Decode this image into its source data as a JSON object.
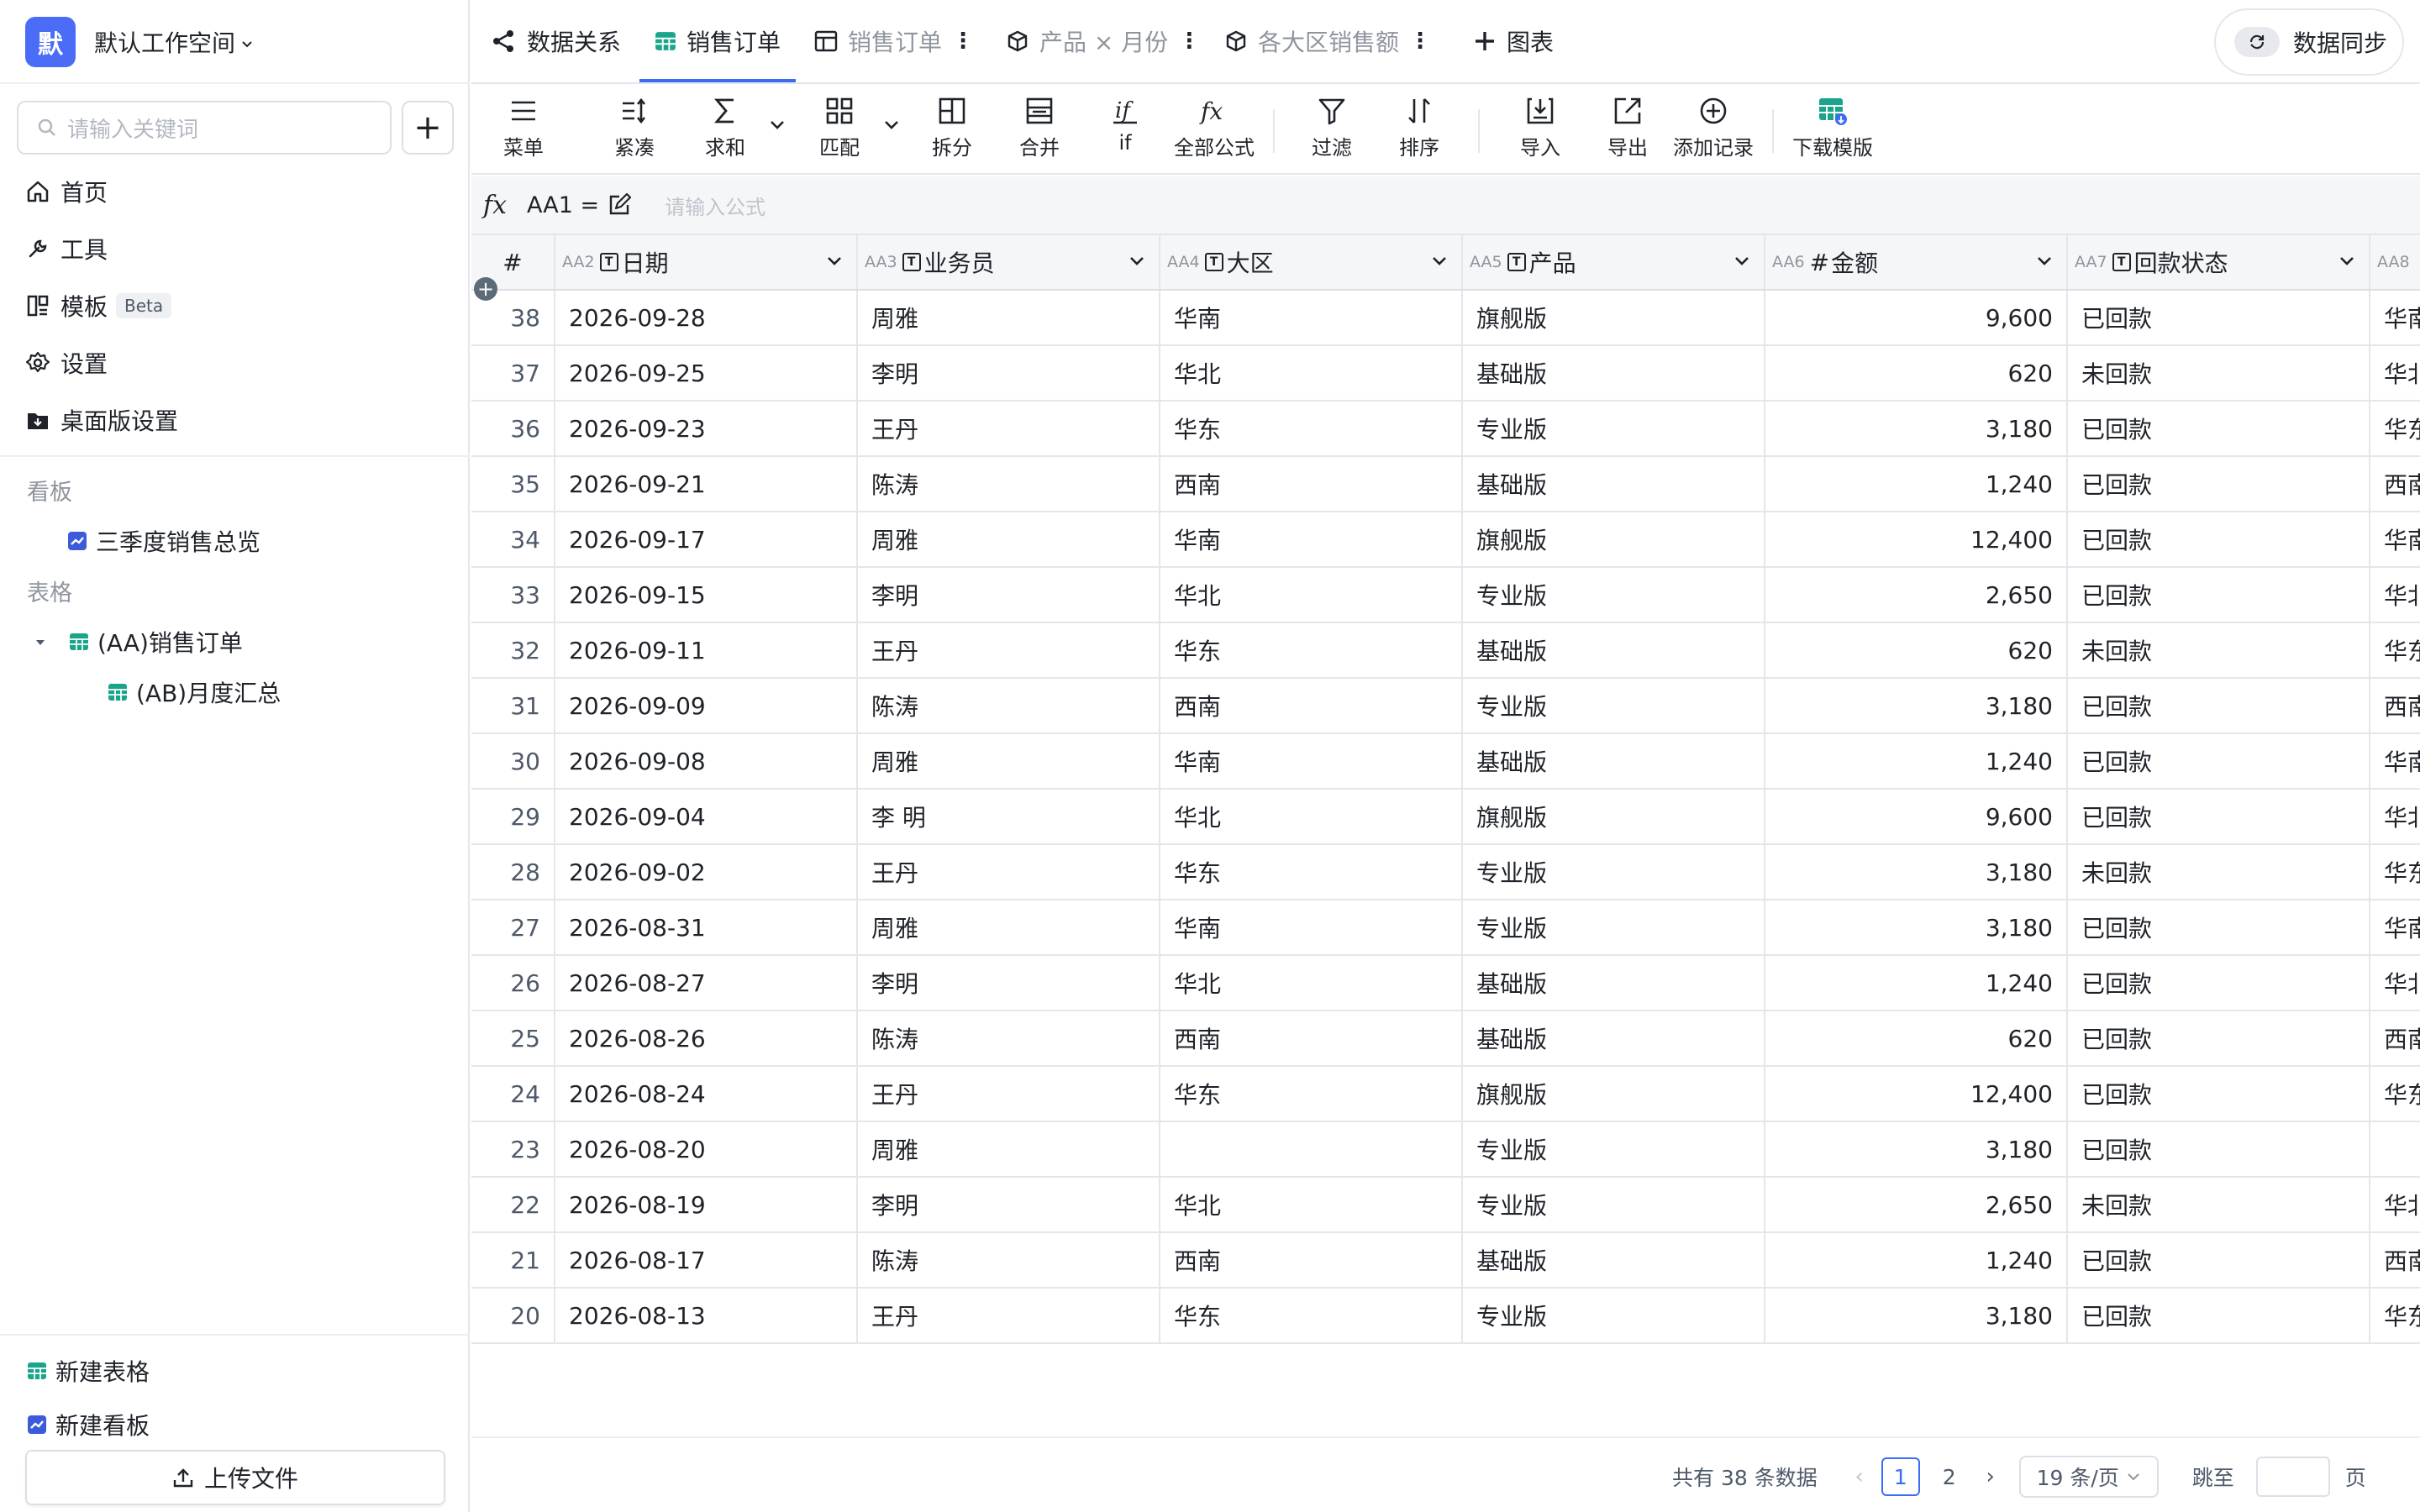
{
  "workspace": {
    "avatar": "默",
    "name": "默认工作空间"
  },
  "search": {
    "placeholder": "请输入关键词"
  },
  "nav": [
    {
      "label": "首页"
    },
    {
      "label": "工具"
    },
    {
      "label": "模板",
      "badge": "Beta"
    },
    {
      "label": "设置"
    },
    {
      "label": "桌面版设置"
    }
  ],
  "sections": {
    "boards": "看板",
    "tables": "表格"
  },
  "board_items": [
    {
      "label": "三季度销售总览"
    }
  ],
  "table_tree": [
    {
      "label": "(AA)销售订单"
    },
    {
      "label": "(AB)月度汇总"
    }
  ],
  "sidebar_footer": {
    "new_table": "新建表格",
    "new_board": "新建看板",
    "upload": "上传文件"
  },
  "tabs": [
    {
      "label": "数据关系"
    },
    {
      "label": "销售订单"
    },
    {
      "label": "销售订单"
    },
    {
      "label": "产品 × 月份"
    },
    {
      "label": "各大区销售额"
    },
    {
      "label": "图表"
    }
  ],
  "sync": {
    "label": "数据同步"
  },
  "toolbar": [
    "菜单",
    "紧凑",
    "求和",
    "匹配",
    "拆分",
    "合并",
    "if",
    "全部公式",
    "过滤",
    "排序",
    "导入",
    "导出",
    "添加记录",
    "下载模版"
  ],
  "formula": {
    "cell": "AA1 =",
    "placeholder": "请输入公式"
  },
  "columns": [
    {
      "id": "",
      "name": "#"
    },
    {
      "id": "AA2",
      "name": "日期",
      "type": "T"
    },
    {
      "id": "AA3",
      "name": "业务员",
      "type": "T"
    },
    {
      "id": "AA4",
      "name": "大区",
      "type": "T"
    },
    {
      "id": "AA5",
      "name": "产品",
      "type": "T"
    },
    {
      "id": "AA6",
      "name": "金额",
      "type": "#"
    },
    {
      "id": "AA7",
      "name": "回款状态",
      "type": "T"
    },
    {
      "id": "AA8",
      "name": "",
      "type": ""
    }
  ],
  "rows": [
    [
      "38",
      "2026-09-28",
      "周雅",
      "华南",
      "旗舰版",
      "9,600",
      "已回款",
      "华南"
    ],
    [
      "37",
      "2026-09-25",
      "李明",
      "华北",
      "基础版",
      "620",
      "未回款",
      "华北"
    ],
    [
      "36",
      "2026-09-23",
      "王丹",
      "华东",
      "专业版",
      "3,180",
      "已回款",
      "华东"
    ],
    [
      "35",
      "2026-09-21",
      "陈涛",
      "西南",
      "基础版",
      "1,240",
      "已回款",
      "西南"
    ],
    [
      "34",
      "2026-09-17",
      "周雅",
      "华南",
      "旗舰版",
      "12,400",
      "已回款",
      "华南"
    ],
    [
      "33",
      "2026-09-15",
      "李明",
      "华北",
      "专业版",
      "2,650",
      "已回款",
      "华北"
    ],
    [
      "32",
      "2026-09-11",
      "王丹",
      "华东",
      "基础版",
      "620",
      "未回款",
      "华东"
    ],
    [
      "31",
      "2026-09-09",
      "陈涛",
      "西南",
      "专业版",
      "3,180",
      "已回款",
      "西南"
    ],
    [
      "30",
      "2026-09-08",
      "周雅",
      "华南",
      "基础版",
      "1,240",
      "已回款",
      "华南"
    ],
    [
      "29",
      "2026-09-04",
      "李 明",
      "华北",
      "旗舰版",
      "9,600",
      "已回款",
      "华北"
    ],
    [
      "28",
      "2026-09-02",
      "王丹",
      "华东",
      "专业版",
      "3,180",
      "未回款",
      "华东"
    ],
    [
      "27",
      "2026-08-31",
      "周雅",
      "华南",
      "专业版",
      "3,180",
      "已回款",
      "华南"
    ],
    [
      "26",
      "2026-08-27",
      "李明",
      "华北",
      "基础版",
      "1,240",
      "已回款",
      "华北"
    ],
    [
      "25",
      "2026-08-26",
      "陈涛",
      "西南",
      "基础版",
      "620",
      "已回款",
      "西南"
    ],
    [
      "24",
      "2026-08-24",
      "王丹",
      "华东",
      "旗舰版",
      "12,400",
      "已回款",
      "华东"
    ],
    [
      "23",
      "2026-08-20",
      "周雅",
      "",
      "专业版",
      "3,180",
      "已回款",
      ""
    ],
    [
      "22",
      "2026-08-19",
      "李明",
      "华北",
      "专业版",
      "2,650",
      "未回款",
      "华北"
    ],
    [
      "21",
      "2026-08-17",
      "陈涛",
      "西南",
      "基础版",
      "1,240",
      "已回款",
      "西南"
    ],
    [
      "20",
      "2026-08-13",
      "王丹",
      "华东",
      "专业版",
      "3,180",
      "已回款",
      "华东"
    ]
  ],
  "pagination": {
    "total": "共有 38 条数据",
    "pages": [
      "1",
      "2"
    ],
    "current": "1",
    "page_size": "19 条/页",
    "jump_label": "跳至",
    "unit": "页"
  },
  "colors": {
    "accent": "#3b6cf6",
    "workspace_avatar": "#4a6cf7",
    "table_icon": "#1aa58a",
    "board_icon": "#3b5bdb"
  }
}
